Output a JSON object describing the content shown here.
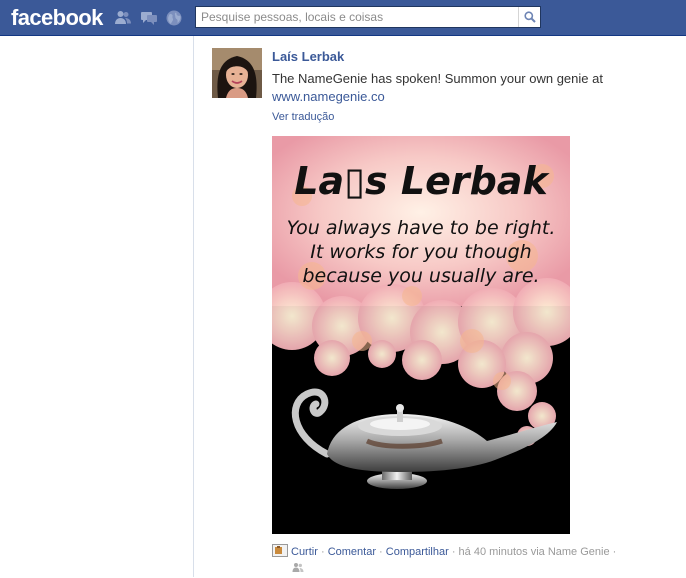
{
  "topbar": {
    "logo": "facebook",
    "icons": [
      "friend-requests-icon",
      "messages-icon",
      "notifications-globe-icon"
    ],
    "search": {
      "placeholder": "Pesquise pessoas, locais e coisas",
      "value": ""
    }
  },
  "post": {
    "author": "Laís Lerbak",
    "message": "The NameGenie has spoken! Summon your own genie at",
    "link": "www.namegenie.co",
    "translate": "Ver tradução",
    "image": {
      "name_line": "La▯s Lerbak",
      "fortune": [
        "You always have to be right.",
        "It works for you though",
        "because you usually are."
      ]
    },
    "actions": {
      "like": "Curtir",
      "comment": "Comentar",
      "share": "Compartilhar",
      "meta": "há 40 minutos via Name Genie"
    }
  },
  "colors": {
    "brand": "#3b5998",
    "link": "#3b5998",
    "muted": "#999999"
  }
}
